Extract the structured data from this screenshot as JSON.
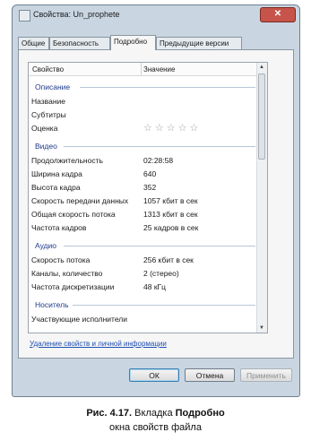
{
  "window": {
    "title": "Свойства: Un_prophete",
    "close_glyph": "✕"
  },
  "tabs": [
    {
      "label": "Общие",
      "active": false
    },
    {
      "label": "Безопасность",
      "active": false
    },
    {
      "label": "Подробно",
      "active": true
    },
    {
      "label": "Предыдущие версии",
      "active": false
    }
  ],
  "table": {
    "col_property": "Свойство",
    "col_value": "Значение",
    "groups": {
      "description": "Описание",
      "video": "Видео",
      "audio": "Аудио",
      "media": "Носитель"
    },
    "rows": {
      "name": {
        "k": "Название",
        "v": ""
      },
      "subtitle": {
        "k": "Субтитры",
        "v": ""
      },
      "rating": {
        "k": "Оценка",
        "v": "☆☆☆☆☆"
      },
      "duration": {
        "k": "Продолжительность",
        "v": "02:28:58"
      },
      "width": {
        "k": "Ширина кадра",
        "v": "640"
      },
      "height": {
        "k": "Высота кадра",
        "v": "352"
      },
      "datarate": {
        "k": "Скорость передачи данных",
        "v": "1057 кбит в сек"
      },
      "bitrate": {
        "k": "Общая скорость потока",
        "v": "1313 кбит в сек"
      },
      "framerate": {
        "k": "Частота кадров",
        "v": "25 кадров в сек"
      },
      "abitrate": {
        "k": "Скорость потока",
        "v": "256 кбит в сек"
      },
      "channels": {
        "k": "Каналы, количество",
        "v": "2 (стерео)"
      },
      "samplerate": {
        "k": "Частота дискретизации",
        "v": "48 кГц"
      },
      "contributors": {
        "k": "Участвующие исполнители",
        "v": ""
      }
    }
  },
  "link": "Удаление свойств и личной информации",
  "buttons": {
    "ok": "ОК",
    "cancel": "Отмена",
    "apply": "Применить"
  },
  "caption": {
    "fig": "Рис. 4.17.",
    "text1": " Вкладка ",
    "bold": "Подробно",
    "line2": "окна свойств файла"
  }
}
